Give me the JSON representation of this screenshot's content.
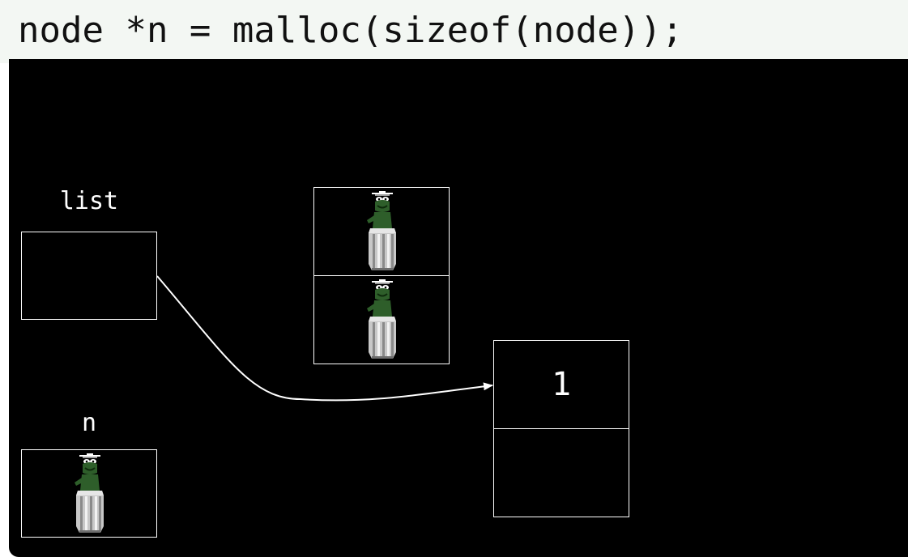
{
  "code": {
    "line": "node *n = malloc(sizeof(node));"
  },
  "diagram": {
    "list_label": "list",
    "n_label": "n",
    "node_value": "1",
    "garbage_icon": "oscar-trash-can-icon",
    "colors": {
      "background": "#000000",
      "code_bar": "#f3f7f3",
      "stroke": "#ffffff",
      "oscar_green": "#2e5e2a",
      "can_silver": "#c8c8c8"
    }
  }
}
